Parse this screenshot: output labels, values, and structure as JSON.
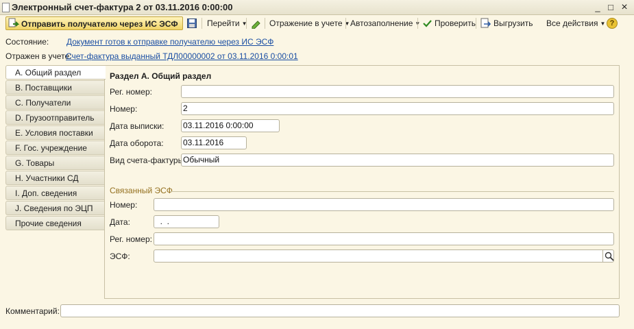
{
  "window": {
    "title": "Электронный счет-фактура 2 от 03.11.2016 0:00:00",
    "controls": {
      "minimize": "_",
      "maximize": "□",
      "close": "×"
    }
  },
  "toolbar": {
    "send_label": "Отправить получателю через ИС ЭСФ",
    "goto_label": "Перейти",
    "posting_label": "Отражение в учете",
    "autofill_label": "Автозаполнение",
    "check_label": "Проверить",
    "export_label": "Выгрузить",
    "all_actions_label": "Все действия",
    "help_label": "?"
  },
  "status": {
    "state_label": "Состояние:",
    "state_value": "Документ готов к отправке получателю через ИС ЭСФ",
    "posted_label": "Отражен в учете:",
    "posted_value": "Счет-фактура выданный ТДЛ00000002 от 03.11.2016 0:00:01"
  },
  "tabs": [
    {
      "label": "А. Общий раздел",
      "active": true
    },
    {
      "label": "В. Поставщики"
    },
    {
      "label": "С. Получатели"
    },
    {
      "label": "D. Грузоотправитель"
    },
    {
      "label": "Е. Условия поставки"
    },
    {
      "label": "F. Гос. учреждение"
    },
    {
      "label": "G. Товары"
    },
    {
      "label": "Н. Участники СД"
    },
    {
      "label": "I. Доп. сведения"
    },
    {
      "label": "J. Сведения по ЭЦП"
    },
    {
      "label": "Прочие сведения"
    }
  ],
  "section_a": {
    "heading": "Раздел А. Общий раздел",
    "reg_number": {
      "label": "Рег. номер:",
      "value": ""
    },
    "number": {
      "label": "Номер:",
      "value": "2"
    },
    "issue_date": {
      "label": "Дата выписки:",
      "value": "03.11.2016  0:00:00"
    },
    "turnover_date": {
      "label": "Дата оборота:",
      "value": "03.11.2016"
    },
    "invoice_type": {
      "label": "Вид счета-фактуры:",
      "value": "Обычный"
    }
  },
  "related": {
    "title": "Связанный ЭСФ",
    "number": {
      "label": "Номер:",
      "value": ""
    },
    "date": {
      "label": "Дата:",
      "value": "  .  ."
    },
    "reg_number": {
      "label": "Рег. номер:",
      "value": ""
    },
    "esf": {
      "label": "ЭСФ:",
      "value": ""
    }
  },
  "comment": {
    "label": "Комментарий:",
    "value": ""
  }
}
